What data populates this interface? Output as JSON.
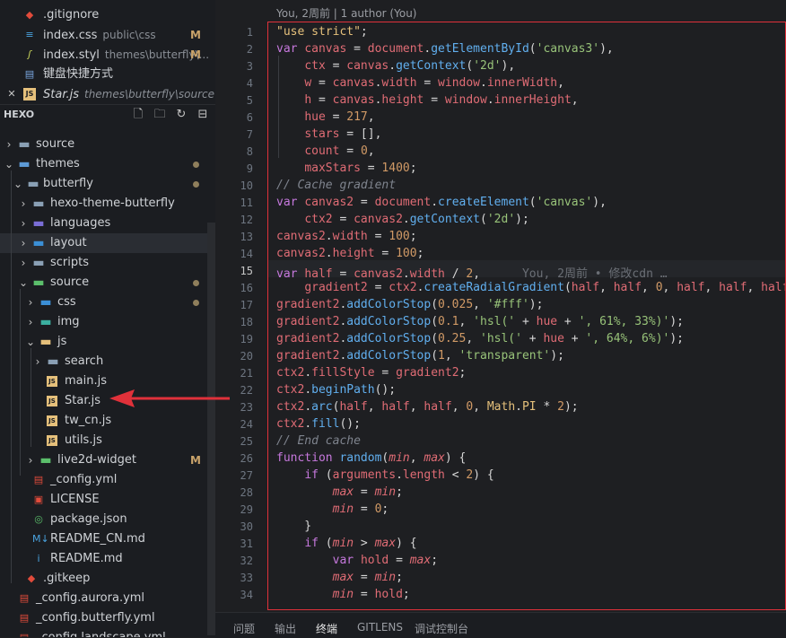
{
  "open_editors": [
    {
      "name": ".gitignore",
      "desc": "",
      "badge": "",
      "icon": "git-icon",
      "color": "#e24b3b"
    },
    {
      "name": "index.css",
      "desc": "public\\css",
      "badge": "M",
      "icon": "css-icon",
      "color": "#4aa3df"
    },
    {
      "name": "index.styl",
      "desc": "themes\\butterfly\\...",
      "badge": "M",
      "icon": "stylus-icon",
      "color": "#c6d25a"
    },
    {
      "name": "键盘快捷方式",
      "desc": "",
      "badge": "",
      "icon": "keyboard-icon",
      "color": "#7aa7e0"
    },
    {
      "name": "Star.js",
      "desc": "themes\\butterfly\\source\\js",
      "badge": "",
      "icon": "js-icon",
      "color": "#e5c07b"
    }
  ],
  "explorer": {
    "title": "HEXO",
    "tree": [
      {
        "name": "source",
        "badge": "",
        "dot": false
      },
      {
        "name": "themes",
        "badge": "",
        "dot": true
      },
      {
        "name": "butterfly",
        "badge": "",
        "dot": true
      },
      {
        "name": "hexo-theme-butterfly",
        "badge": "",
        "dot": false
      },
      {
        "name": "languages",
        "badge": "",
        "dot": false
      },
      {
        "name": "layout",
        "badge": "",
        "dot": false
      },
      {
        "name": "scripts",
        "badge": "",
        "dot": false
      },
      {
        "name": "source",
        "badge": "",
        "dot": true
      },
      {
        "name": "css",
        "badge": "",
        "dot": true
      },
      {
        "name": "img",
        "badge": "",
        "dot": false
      },
      {
        "name": "js",
        "badge": "",
        "dot": false
      },
      {
        "name": "search",
        "badge": "",
        "dot": false
      },
      {
        "name": "main.js",
        "badge": "",
        "dot": false
      },
      {
        "name": "Star.js",
        "badge": "",
        "dot": false
      },
      {
        "name": "tw_cn.js",
        "badge": "",
        "dot": false
      },
      {
        "name": "utils.js",
        "badge": "",
        "dot": false
      },
      {
        "name": "live2d-widget",
        "badge": "M",
        "dot": false
      },
      {
        "name": "_config.yml",
        "badge": "",
        "dot": false
      },
      {
        "name": "LICENSE",
        "badge": "",
        "dot": false
      },
      {
        "name": "package.json",
        "badge": "",
        "dot": false
      },
      {
        "name": "README_CN.md",
        "badge": "",
        "dot": false
      },
      {
        "name": "README.md",
        "badge": "",
        "dot": false
      },
      {
        "name": ".gitkeep",
        "badge": "",
        "dot": false
      },
      {
        "name": "_config.aurora.yml",
        "badge": "",
        "dot": false
      },
      {
        "name": "_config.butterfly.yml",
        "badge": "",
        "dot": false
      },
      {
        "name": "_config.landscape.yml",
        "badge": "",
        "dot": false
      }
    ]
  },
  "editor": {
    "blame_header": "You, 2周前 | 1 author (You)",
    "inline_blame": "You, 2周前 • 修改cdn …",
    "current_line": 15,
    "line_numbers": [
      "1",
      "2",
      "3",
      "4",
      "5",
      "6",
      "7",
      "8",
      "9",
      "10",
      "11",
      "12",
      "13",
      "14",
      "15",
      "16",
      "17",
      "18",
      "19",
      "20",
      "21",
      "22",
      "23",
      "24",
      "25",
      "26",
      "27",
      "28",
      "29",
      "30",
      "31",
      "32",
      "33",
      "34"
    ]
  },
  "panel_tabs": [
    "问题",
    "输出",
    "终端",
    "GITLENS",
    "调试控制台"
  ],
  "active_panel_tab": "终端",
  "colors": {
    "red_box": "#e0313a",
    "arrow": "#e0313a",
    "modified": "#c9a36a"
  }
}
